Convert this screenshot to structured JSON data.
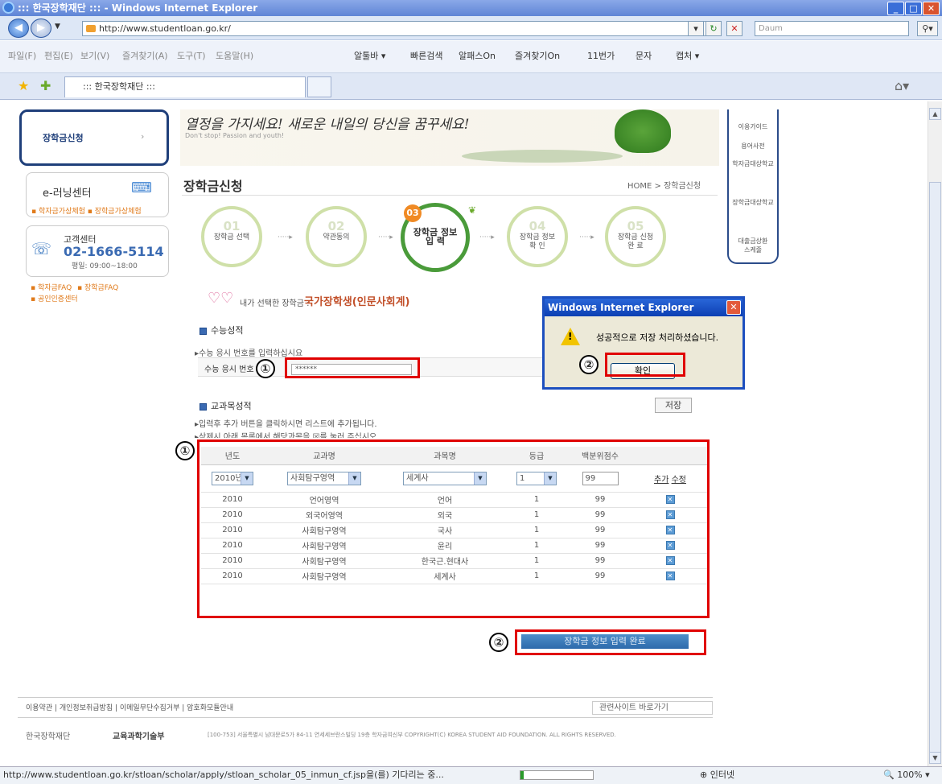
{
  "window": {
    "title": ":::  한국장학재단 :::  - Windows Internet Explorer"
  },
  "address": {
    "url": "http://www.studentloan.go.kr/",
    "search_placeholder": "Daum"
  },
  "menubar": {
    "items": [
      "파일(F)",
      "편집(E)",
      "보기(V)",
      "즐겨찾기(A)",
      "도구(T)",
      "도움말(H)"
    ],
    "toolbar": [
      "알툴바 ▾",
      "빠른검색",
      "알패스On",
      "즐겨찾기On",
      "11번가",
      "문자",
      "캡처 ▾"
    ]
  },
  "tab": {
    "label": "::: 한국장학재단 :::"
  },
  "left_nav": {
    "apply": "장학금신청",
    "elearning": "e-러닝센터",
    "elearning_links": "▪ 학자금가상체험  ▪ 장학금가상체험",
    "cs_label": "고객센터",
    "cs_phone": "02-1666-5114",
    "cs_hours": "평일: 09:00~18:00",
    "links": [
      "▪ 학자금FAQ",
      "▪ 장학금FAQ",
      "▪ 공인인증센터"
    ]
  },
  "right_nav": [
    "이용가이드",
    "용어사전",
    "학자금대상학교",
    "장학금대상학교",
    "대출금상환\n스케줄"
  ],
  "banner": {
    "slogan": "열정을 가지세요! 새로운 내일의 당신을 꿈꾸세요!",
    "sub": "Don't stop! Passion and youth!"
  },
  "page": {
    "title": "장학금신청",
    "breadcrumb": "HOME > 장학금신청"
  },
  "steps": [
    {
      "num": "01",
      "label": "장학금 선택"
    },
    {
      "num": "02",
      "label": "약관동의"
    },
    {
      "num": "03",
      "label": "장학금 정보\n입 력"
    },
    {
      "num": "04",
      "label": "장학금 정보\n확 인"
    },
    {
      "num": "05",
      "label": "장학금 신청\n완 료"
    }
  ],
  "selected": {
    "label": "내가 선택한 장학금 :",
    "value": "국가장학생(인문사회계)"
  },
  "csat": {
    "title": "수능성적",
    "instruction": "▸수능 응시 번호를 입력하십시요",
    "field_label": "수능 응시 번호",
    "field_value": "******"
  },
  "course": {
    "title": "교과목성적",
    "save": "저장",
    "note1": "▸입력후 추가 버튼을 클릭하시면 리스트에 추가됩니다.",
    "note2": "▸삭제시 아래 목록에서 해당과목을 ☒를 눌러 주십시오.",
    "headers": [
      "년도",
      "교과명",
      "과목명",
      "등급",
      "백분위점수"
    ],
    "input": {
      "year": "2010년",
      "subject": "사회탐구영역",
      "course": "세계사",
      "grade": "1",
      "score": "99",
      "add": "추가",
      "edit": "수정"
    },
    "rows": [
      [
        "2010",
        "언어영역",
        "언어",
        "1",
        "99"
      ],
      [
        "2010",
        "외국어영역",
        "외국",
        "1",
        "99"
      ],
      [
        "2010",
        "사회탐구영역",
        "국사",
        "1",
        "99"
      ],
      [
        "2010",
        "사회탐구영역",
        "윤리",
        "1",
        "99"
      ],
      [
        "2010",
        "사회탐구영역",
        "한국근.현대사",
        "1",
        "99"
      ],
      [
        "2010",
        "사회탐구영역",
        "세계사",
        "1",
        "99"
      ]
    ]
  },
  "done_button": "장학금 정보 입력 완료",
  "annotations": {
    "one": "①",
    "two": "②"
  },
  "dialog": {
    "title": "Windows Internet Explorer",
    "message": "성공적으로 저장 처리하셨습니다.",
    "ok": "확인"
  },
  "footer": {
    "links": "이용약관  |  개인정보취급방침  |  이메일무단수집거부  |  암호화모듈안내",
    "related": "관련사이트 바로가기",
    "org": "한국장학재단",
    "ministry": "교육과학기술부",
    "address": "[100-753] 서울특별시 남대문로5가 84-11 연세세브란스빌딩 19층  학자금여신부    COPYRIGHT(C) KOREA STUDENT AID FOUNDATION. ALL RIGHTS RESERVED."
  },
  "status": {
    "text": "http://www.studentloan.go.kr/stloan/scholar/apply/stloan_scholar_05_inmun_cf.jsp을(를) 기다리는 중...",
    "zone": "인터넷",
    "zoom": "100%"
  }
}
